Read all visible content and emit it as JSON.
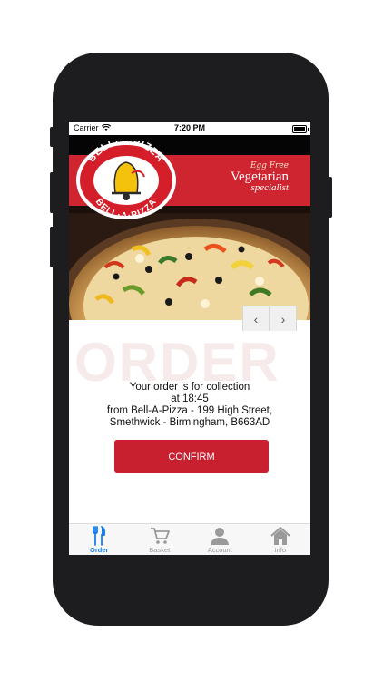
{
  "status": {
    "carrier": "Carrier",
    "time": "7:20 PM"
  },
  "brand": {
    "logo_text_top": "BELL·A·PIZZA",
    "logo_text_bottom": "BELL·A·PIZZA",
    "tag_small": "Egg Free",
    "tag_main": "Vegetarian",
    "tag_sub": "specialist",
    "colors": {
      "red": "#cf2530",
      "blue": "#1a7ee6"
    }
  },
  "carousel": {
    "prev_icon": "chevron-left-icon",
    "next_icon": "chevron-right-icon",
    "prev": "‹",
    "next": "›"
  },
  "order": {
    "watermark": "ORDER",
    "line1": "Your order is for collection",
    "line2": "at 18:45",
    "line3": "from Bell-A-Pizza - 199 High Street,",
    "line4": "Smethwick - Birmingham, B663AD",
    "confirm_label": "CONFIRM"
  },
  "tabs": [
    {
      "label": "Order",
      "icon": "fork-knife-icon",
      "active": true
    },
    {
      "label": "Basket",
      "icon": "cart-icon",
      "active": false
    },
    {
      "label": "Account",
      "icon": "person-icon",
      "active": false
    },
    {
      "label": "Info",
      "icon": "house-icon",
      "active": false
    }
  ]
}
